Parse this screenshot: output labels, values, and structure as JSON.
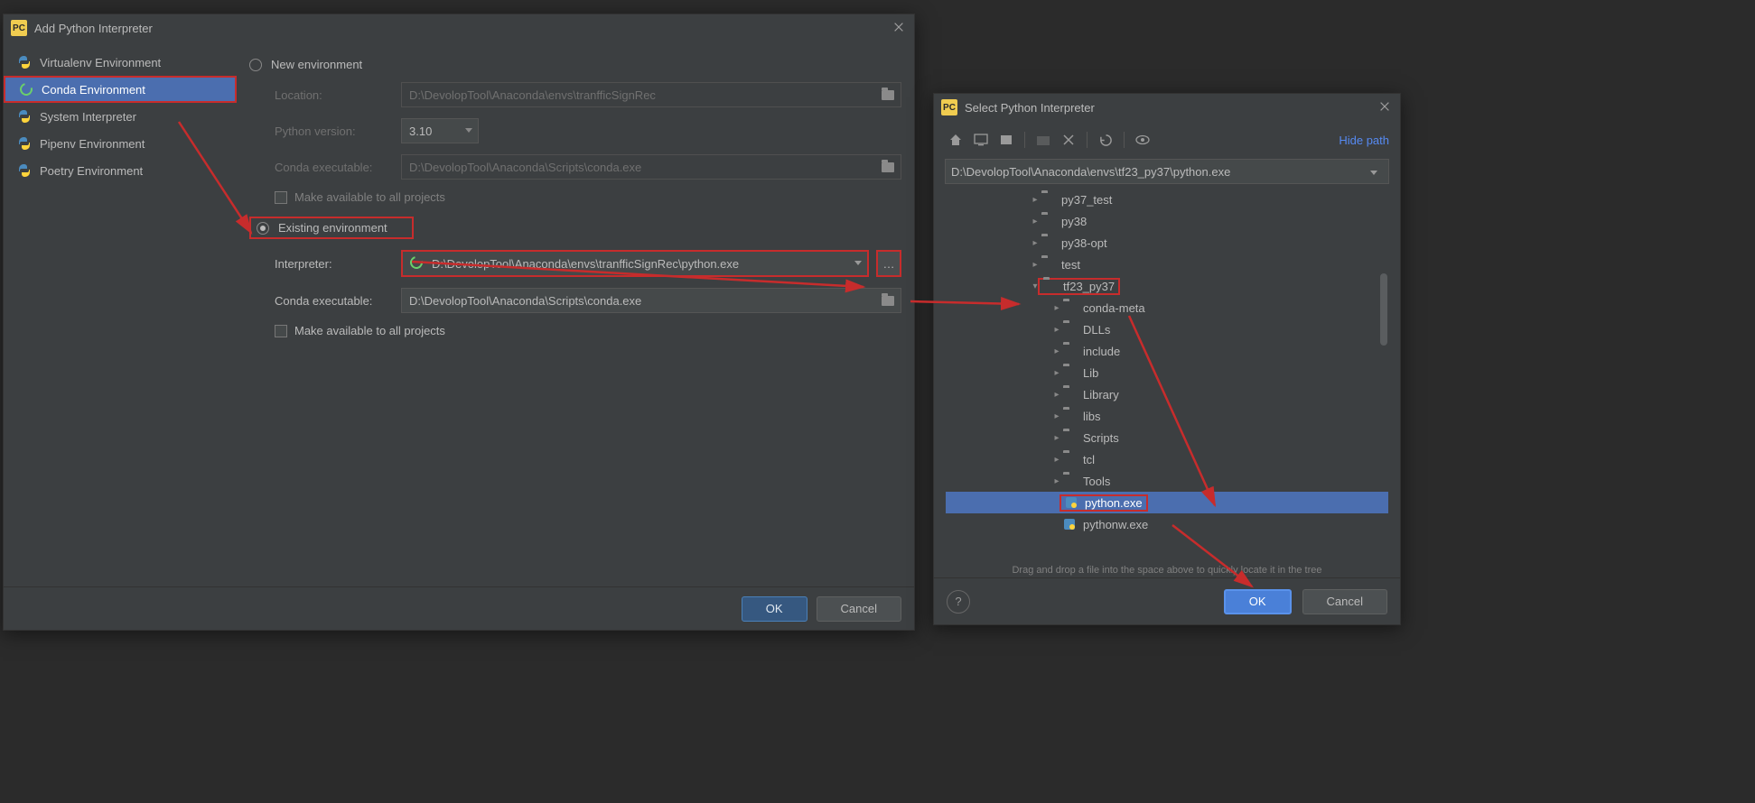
{
  "leftDialog": {
    "title": "Add Python Interpreter",
    "sidebar": {
      "items": [
        {
          "label": "Virtualenv Environment",
          "icon": "python"
        },
        {
          "label": "Conda Environment",
          "icon": "conda",
          "active": true,
          "highlighted": true
        },
        {
          "label": "System Interpreter",
          "icon": "python"
        },
        {
          "label": "Pipenv Environment",
          "icon": "python"
        },
        {
          "label": "Poetry Environment",
          "icon": "python"
        }
      ]
    },
    "newEnv": {
      "radio": "New environment",
      "locationLabel": "Location:",
      "locationValue": "D:\\DevolopTool\\Anaconda\\envs\\tranfficSignRec",
      "pyVersionLabel": "Python version:",
      "pyVersionValue": "3.10",
      "condaExecLabel": "Conda executable:",
      "condaExecValue": "D:\\DevolopTool\\Anaconda\\Scripts\\conda.exe",
      "checkbox": "Make available to all projects"
    },
    "existingEnv": {
      "radio": "Existing environment",
      "interpLabel": "Interpreter:",
      "interpValue": "D:\\DevolopTool\\Anaconda\\envs\\tranfficSignRec\\python.exe",
      "condaExecLabel": "Conda executable:",
      "condaExecValue": "D:\\DevolopTool\\Anaconda\\Scripts\\conda.exe",
      "checkbox": "Make available to all projects"
    },
    "buttons": {
      "ok": "OK",
      "cancel": "Cancel"
    }
  },
  "rightDialog": {
    "title": "Select Python Interpreter",
    "hidePath": "Hide path",
    "pathValue": "D:\\DevolopTool\\Anaconda\\envs\\tf23_py37\\python.exe",
    "tree": [
      {
        "label": "py37_test",
        "depth": 3,
        "type": "folder",
        "collapsed": true
      },
      {
        "label": "py38",
        "depth": 3,
        "type": "folder",
        "collapsed": true
      },
      {
        "label": "py38-opt",
        "depth": 3,
        "type": "folder",
        "collapsed": true
      },
      {
        "label": "test",
        "depth": 3,
        "type": "folder",
        "collapsed": true
      },
      {
        "label": "tf23_py37",
        "depth": 3,
        "type": "folder",
        "collapsed": false,
        "highlighted": true
      },
      {
        "label": "conda-meta",
        "depth": 4,
        "type": "folder",
        "collapsed": true
      },
      {
        "label": "DLLs",
        "depth": 4,
        "type": "folder",
        "collapsed": true
      },
      {
        "label": "include",
        "depth": 4,
        "type": "folder",
        "collapsed": true
      },
      {
        "label": "Lib",
        "depth": 4,
        "type": "folder",
        "collapsed": true
      },
      {
        "label": "Library",
        "depth": 4,
        "type": "folder",
        "collapsed": true
      },
      {
        "label": "libs",
        "depth": 4,
        "type": "folder",
        "collapsed": true
      },
      {
        "label": "Scripts",
        "depth": 4,
        "type": "folder",
        "collapsed": true
      },
      {
        "label": "tcl",
        "depth": 4,
        "type": "folder",
        "collapsed": true
      },
      {
        "label": "Tools",
        "depth": 4,
        "type": "folder",
        "collapsed": true
      },
      {
        "label": "python.exe",
        "depth": 4,
        "type": "pyfile",
        "selected": true,
        "highlighted": true
      },
      {
        "label": "pythonw.exe",
        "depth": 4,
        "type": "pyfile"
      }
    ],
    "dragHint": "Drag and drop a file into the space above to quickly locate it in the tree",
    "buttons": {
      "ok": "OK",
      "cancel": "Cancel"
    }
  }
}
